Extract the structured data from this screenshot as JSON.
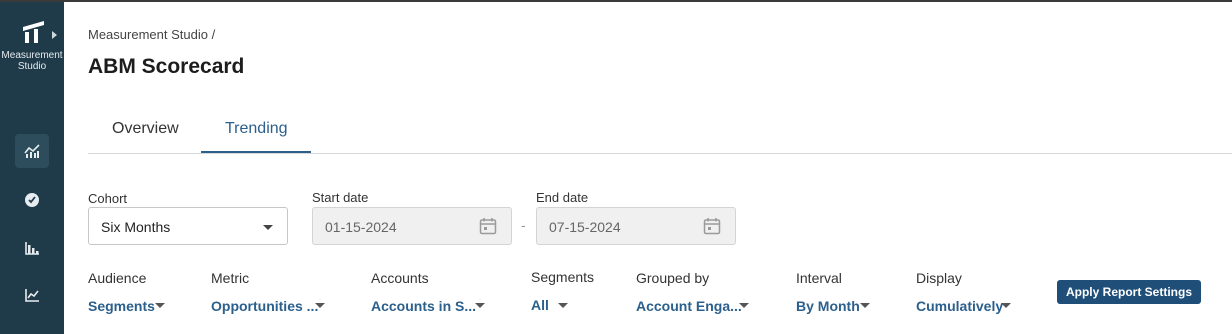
{
  "sidebar": {
    "app_label": "Measurement Studio",
    "nav": [
      {
        "icon": "trend-chart-icon",
        "active": true
      },
      {
        "icon": "check-circle-icon",
        "active": false
      },
      {
        "icon": "bar-chart-icon",
        "active": false
      },
      {
        "icon": "line-chart-icon",
        "active": false
      }
    ]
  },
  "header": {
    "breadcrumb": "Measurement Studio /",
    "title": "ABM Scorecard"
  },
  "tabs": [
    {
      "label": "Overview",
      "active": false
    },
    {
      "label": "Trending",
      "active": true
    }
  ],
  "filters": {
    "cohort": {
      "label": "Cohort",
      "value": "Six Months"
    },
    "start_date": {
      "label": "Start date",
      "value": "01-15-2024"
    },
    "separator": "-",
    "end_date": {
      "label": "End date",
      "value": "07-15-2024"
    }
  },
  "settings": [
    {
      "label": "Audience",
      "value": "Segments"
    },
    {
      "label": "Metric",
      "value": "Opportunities ..."
    },
    {
      "label": "Accounts",
      "value": "Accounts in S..."
    },
    {
      "label": "Segments",
      "value": "All"
    },
    {
      "label": "Grouped by",
      "value": "Account Enga..."
    },
    {
      "label": "Interval",
      "value": "By Month"
    },
    {
      "label": "Display",
      "value": "Cumulatively"
    }
  ],
  "apply_label": "Apply Report Settings",
  "colors": {
    "sidebar": "#1f3a48",
    "accent": "#2b5f8c",
    "button": "#1f4e79"
  }
}
